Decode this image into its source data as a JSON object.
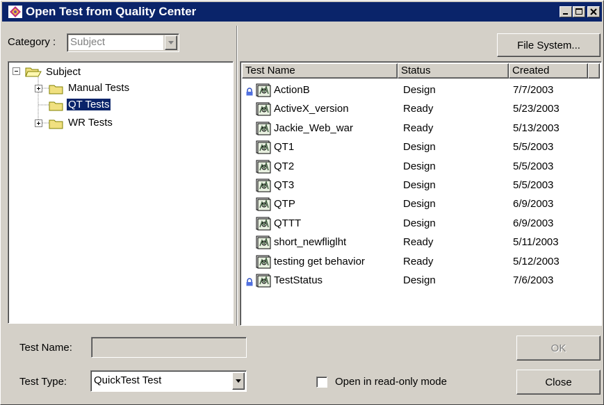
{
  "window": {
    "title": "Open Test from Quality Center"
  },
  "category": {
    "label": "Category :",
    "value": "Subject"
  },
  "toolbar": {
    "file_system_label": "File System..."
  },
  "tree": {
    "root": "Subject",
    "children": [
      "Manual Tests",
      "QT Tests",
      "WR Tests"
    ],
    "selected": "QT Tests"
  },
  "list": {
    "columns": [
      "Test Name",
      "Status",
      "Created"
    ],
    "rows": [
      {
        "name": "ActionB",
        "status": "Design",
        "created": "7/7/2003",
        "locked": true
      },
      {
        "name": "ActiveX_version",
        "status": "Ready",
        "created": "5/23/2003",
        "locked": false
      },
      {
        "name": "Jackie_Web_war",
        "status": "Ready",
        "created": "5/13/2003",
        "locked": false
      },
      {
        "name": "QT1",
        "status": "Design",
        "created": "5/5/2003",
        "locked": false
      },
      {
        "name": "QT2",
        "status": "Design",
        "created": "5/5/2003",
        "locked": false
      },
      {
        "name": "QT3",
        "status": "Design",
        "created": "5/5/2003",
        "locked": false
      },
      {
        "name": "QTP",
        "status": "Design",
        "created": "6/9/2003",
        "locked": false
      },
      {
        "name": "QTTT",
        "status": "Design",
        "created": "6/9/2003",
        "locked": false
      },
      {
        "name": "short_newfliglht",
        "status": "Ready",
        "created": "5/11/2003",
        "locked": false
      },
      {
        "name": "testing get behavior",
        "status": "Ready",
        "created": "5/12/2003",
        "locked": false
      },
      {
        "name": "TestStatus",
        "status": "Design",
        "created": "7/6/2003",
        "locked": true
      }
    ]
  },
  "form": {
    "test_name_label": "Test Name:",
    "test_name_value": "",
    "test_type_label": "Test Type:",
    "test_type_value": "QuickTest Test",
    "readonly_label": "Open in read-only mode",
    "readonly_checked": false
  },
  "buttons": {
    "ok_label": "OK",
    "close_label": "Close"
  },
  "colors": {
    "titlebar": "#0a246a",
    "face": "#d4d0c8",
    "selection": "#0a246a"
  }
}
